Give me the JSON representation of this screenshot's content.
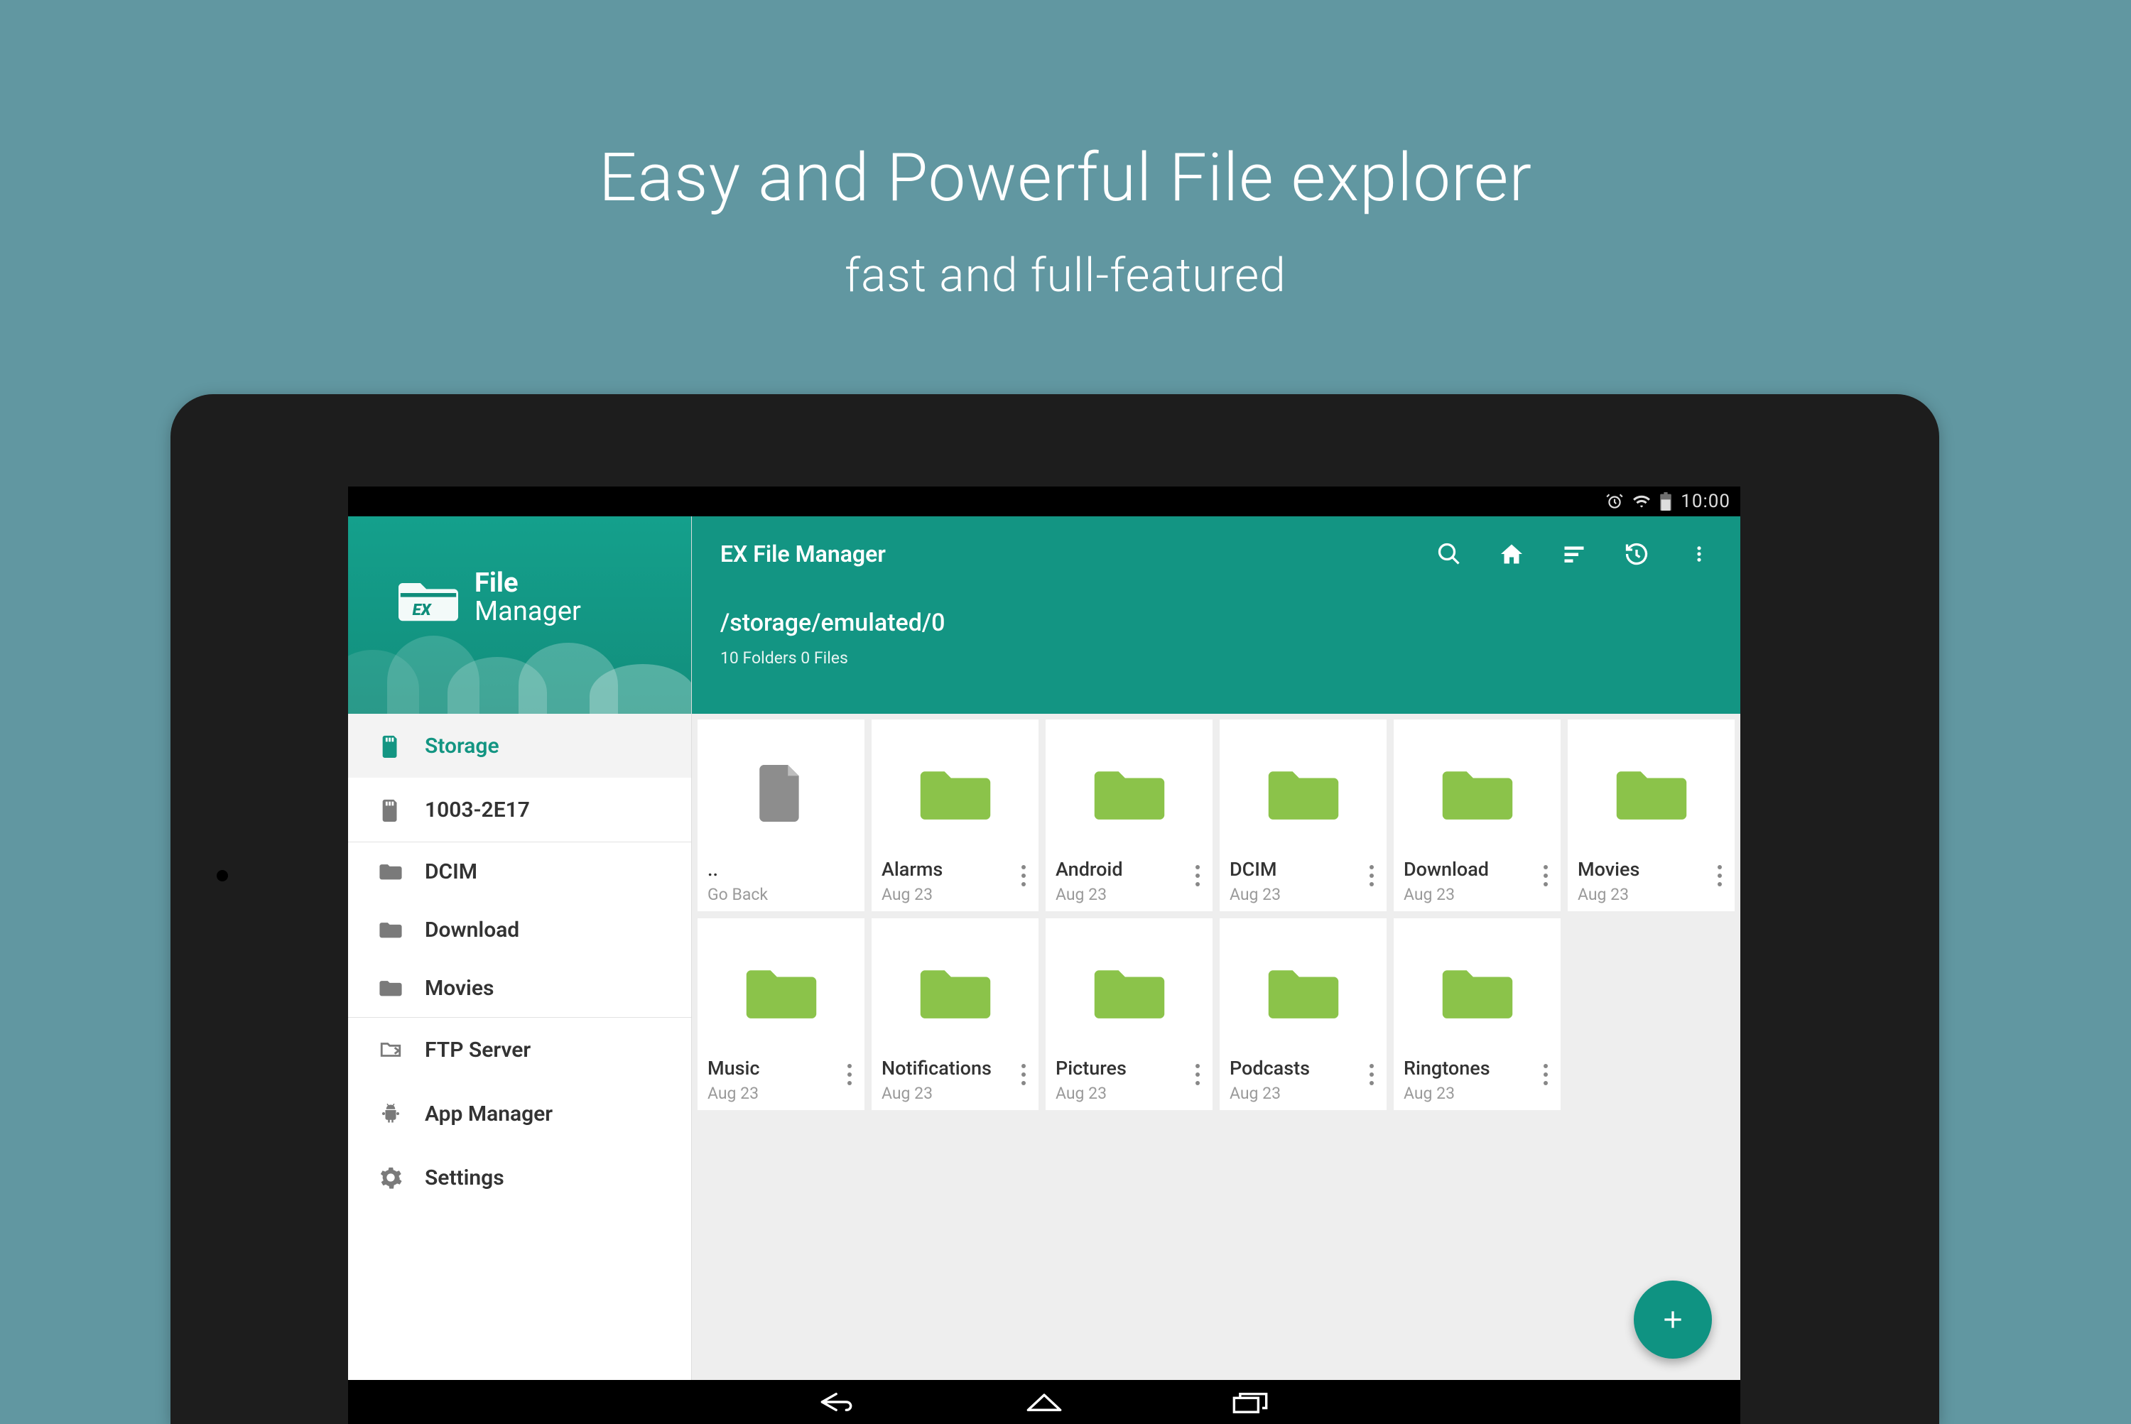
{
  "promo": {
    "headline": "Easy and Powerful File explorer",
    "subhead": "fast and full-featured"
  },
  "status": {
    "time": "10:00"
  },
  "logo": {
    "line1": "File",
    "line2": "Manager"
  },
  "appbar": {
    "title": "EX File Manager",
    "path": "/storage/emulated/0",
    "summary": "10 Folders 0 Files"
  },
  "sidebar": {
    "items": [
      {
        "label": "Storage",
        "icon": "sd",
        "selected": true
      },
      {
        "label": "1003-2E17",
        "icon": "sd-dark",
        "selected": false
      },
      {
        "label": "DCIM",
        "icon": "folder",
        "selected": false
      },
      {
        "label": "Download",
        "icon": "folder",
        "selected": false
      },
      {
        "label": "Movies",
        "icon": "folder",
        "selected": false
      },
      {
        "label": "FTP Server",
        "icon": "ftp",
        "selected": false
      },
      {
        "label": "App Manager",
        "icon": "android",
        "selected": false
      },
      {
        "label": "Settings",
        "icon": "gear",
        "selected": false
      }
    ]
  },
  "grid": {
    "items": [
      {
        "name": "..",
        "date": "Go Back",
        "type": "file"
      },
      {
        "name": "Alarms",
        "date": "Aug 23",
        "type": "folder"
      },
      {
        "name": "Android",
        "date": "Aug 23",
        "type": "folder"
      },
      {
        "name": "DCIM",
        "date": "Aug 23",
        "type": "folder"
      },
      {
        "name": "Download",
        "date": "Aug 23",
        "type": "folder"
      },
      {
        "name": "Movies",
        "date": "Aug 23",
        "type": "folder"
      },
      {
        "name": "Music",
        "date": "Aug 23",
        "type": "folder"
      },
      {
        "name": "Notifications",
        "date": "Aug 23",
        "type": "folder"
      },
      {
        "name": "Pictures",
        "date": "Aug 23",
        "type": "folder"
      },
      {
        "name": "Podcasts",
        "date": "Aug 23",
        "type": "folder"
      },
      {
        "name": "Ringtones",
        "date": "Aug 23",
        "type": "folder"
      }
    ]
  },
  "colors": {
    "accent": "#139583",
    "folder": "#8bc34a",
    "bg": "#6197a1"
  }
}
